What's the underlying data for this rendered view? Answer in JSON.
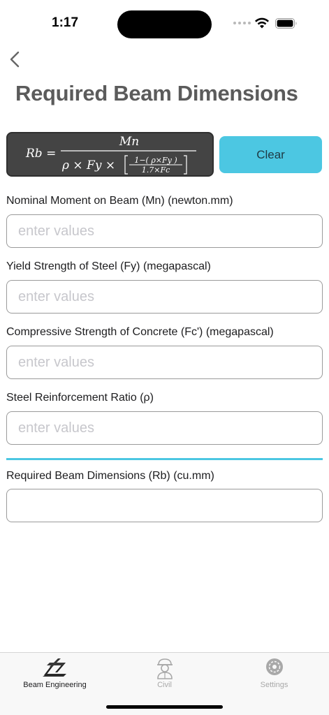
{
  "status_bar": {
    "time": "1:17"
  },
  "page": {
    "title": "Required Beam Dimensions"
  },
  "formula": {
    "lhs": "Rb =",
    "numerator": "Mn",
    "denominator_main": "ρ × Fy ×",
    "inner_numerator": "1−( ρ×Fy )",
    "inner_denominator": "1.7×Fc"
  },
  "actions": {
    "clear_label": "Clear"
  },
  "fields": [
    {
      "label": "Nominal Moment on Beam (Mn) (newton.mm)",
      "placeholder": "enter values",
      "value": ""
    },
    {
      "label": "Yield Strength of Steel (Fy) (megapascal)",
      "placeholder": "enter values",
      "value": ""
    },
    {
      "label": "Compressive Strength of Concrete (Fc') (megapascal)",
      "placeholder": "enter values",
      "value": ""
    },
    {
      "label": "Steel Reinforcement Ratio (ρ)",
      "placeholder": "enter values",
      "value": ""
    }
  ],
  "result": {
    "label": "Required Beam Dimensions (Rb) (cu.mm)",
    "value": ""
  },
  "tabs": [
    {
      "label": "Beam Engineering",
      "icon": "beam-icon",
      "active": true
    },
    {
      "label": "Civil",
      "icon": "engineer-icon",
      "active": false
    },
    {
      "label": "Settings",
      "icon": "gear-icon",
      "active": false
    }
  ],
  "colors": {
    "accent": "#4cc7e2",
    "formula_bg": "#444444",
    "title": "#5b5b5b",
    "inactive_tab": "#a8a8a8"
  }
}
